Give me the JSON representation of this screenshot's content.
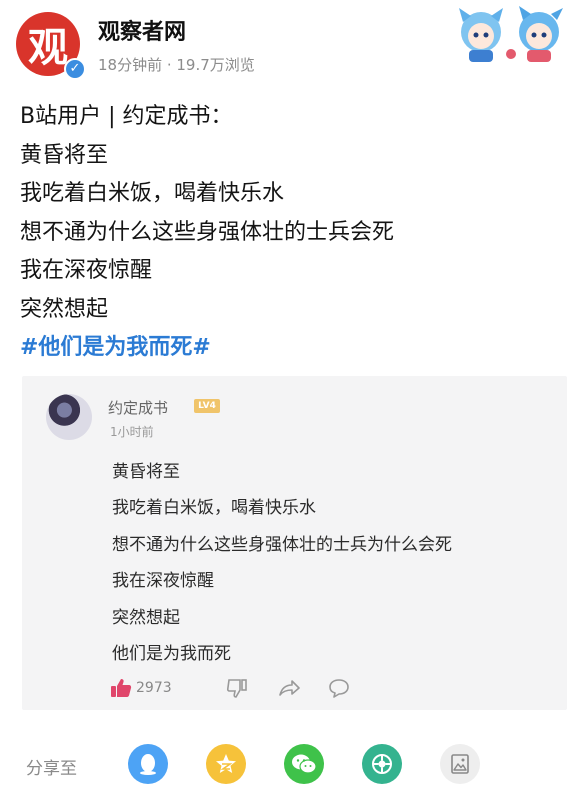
{
  "header": {
    "account_name": "观察者网",
    "meta": "18分钟前 · 19.7万浏览",
    "avatar_glyph": "观"
  },
  "post": {
    "lines": [
      "B站用户 | 约定成书：",
      "黄昏将至",
      "我吃着白米饭，喝着快乐水",
      "想不通为什么这些身强体壮的士兵会死",
      "我在深夜惊醒",
      "突然想起"
    ],
    "hashtag": "#他们是为我而死#",
    "hashtag_color": "#2b7bd4"
  },
  "embedded_comment": {
    "user": "约定成书",
    "level_badge": "LV4",
    "time": "1小时前",
    "lines": [
      "黄昏将至",
      "我吃着白米饭，喝着快乐水",
      "想不通为什么这些身强体壮的士兵为什么会死",
      "我在深夜惊醒",
      "突然想起",
      "他们是为我而死"
    ],
    "like_count": "2973",
    "like_color": "#e0466b"
  },
  "share": {
    "label": "分享至",
    "targets": [
      {
        "icon": "qq-icon",
        "color": "#4da3f5"
      },
      {
        "icon": "qzone-icon",
        "color": "#f6c23a"
      },
      {
        "icon": "wechat-icon",
        "color": "#3fc24a"
      },
      {
        "icon": "moments-icon",
        "color": "#34b38f"
      },
      {
        "icon": "image-icon",
        "color": "#eeeeee"
      }
    ]
  }
}
